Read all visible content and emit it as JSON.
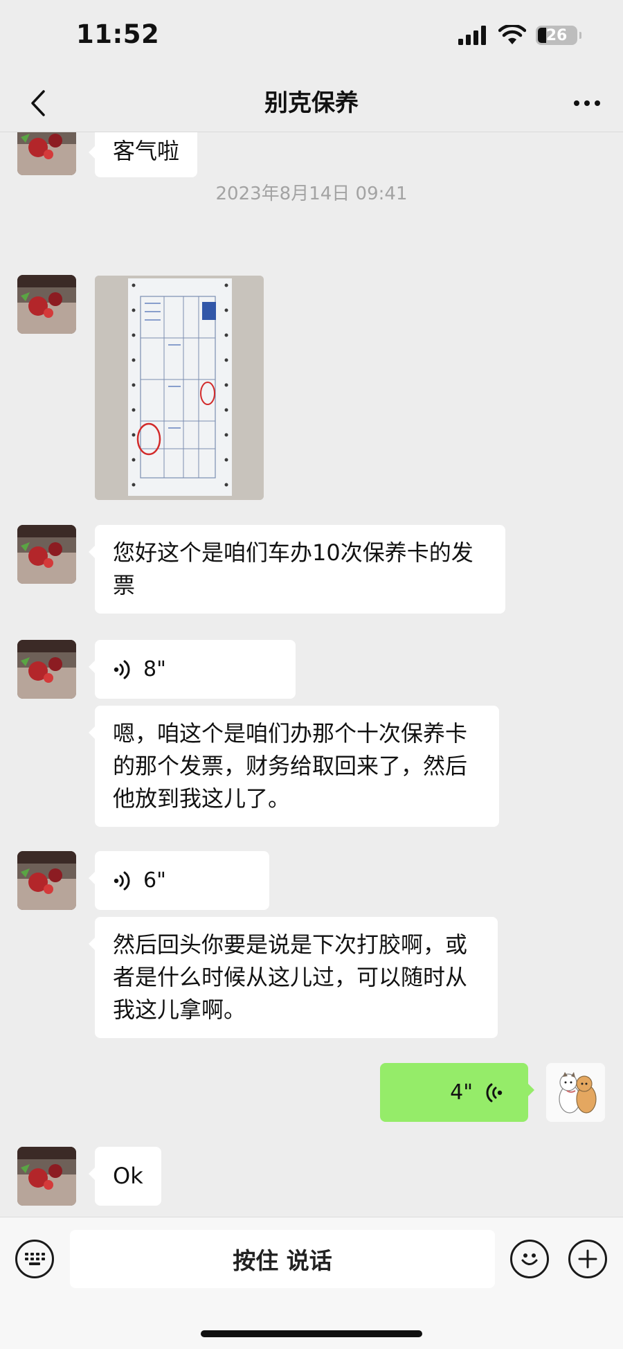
{
  "status_bar": {
    "time": "11:52",
    "battery": "26"
  },
  "nav": {
    "title": "别克保养",
    "back_icon": "chevron-left-icon",
    "more_icon": "more-dots-icon"
  },
  "timestamp": "2023年8月14日 09:41",
  "messages": {
    "m1": {
      "text": "客气啦"
    },
    "m2": {
      "type": "image",
      "description_icon": "invoice-photo"
    },
    "m3": {
      "text": "您好这个是咱们车办10次保养卡的发票"
    },
    "m4": {
      "duration": "8\""
    },
    "m5": {
      "text": "嗯，咱这个是咱们办那个十次保养卡的那个发票，财务给取回来了，然后他放到我这儿了。"
    },
    "m6": {
      "duration": "6\""
    },
    "m7": {
      "text": "然后回头你要是说是下次打胶啊，或者是什么时候从这儿过，可以随时从我这儿拿啊。"
    },
    "m8": {
      "duration": "4\""
    },
    "m9": {
      "text": "Ok"
    }
  },
  "input_bar": {
    "hold_to_talk": "按住 说话",
    "keyboard_icon": "keyboard-icon",
    "emoji_icon": "emoji-icon",
    "plus_icon": "plus-icon"
  },
  "colors": {
    "background": "#ededed",
    "outgoing_bubble": "#95ec69",
    "incoming_bubble": "#ffffff"
  }
}
